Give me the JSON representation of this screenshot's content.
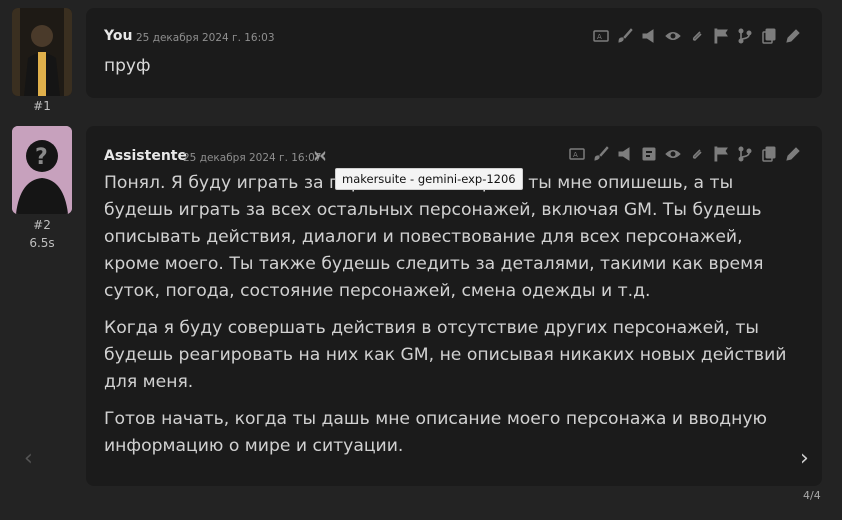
{
  "colors": {
    "background": "#232323",
    "bubble": "#1b1b1b",
    "text": "#d1d1d1",
    "muted": "#8f8f8f",
    "icon": "#7d7d7d",
    "avatar2_bg": "#c7a1bd"
  },
  "messages": [
    {
      "index_label": "#1",
      "author": "You",
      "timestamp": "25 декабря 2024 г. 16:03",
      "text": "пруф",
      "icons": [
        "translate-icon",
        "brush-icon",
        "megaphone-icon",
        "eye-icon",
        "paperclip-icon",
        "flag-icon",
        "branch-icon",
        "copy-icon",
        "pencil-icon"
      ]
    },
    {
      "index_label": "#2",
      "time_taken": "6.5s",
      "author": "Assistente",
      "timestamp": "25 декабря 2024 г. 16:07",
      "model_tooltip": "makersuite - gemini-exp-1206",
      "paragraphs": [
        "Понял. Я буду играть за персонажа, которого ты мне опишешь, а ты будешь играть за всех остальных персонажей, включая GM. Ты будешь описывать действия, диалоги и повествование для всех персонажей, кроме моего. Ты также будешь следить за деталями, такими как время суток, погода, состояние персонажей, смена одежды и т.д.",
        "Когда я буду совершать действия в отсутствие других персонажей, ты будешь реагировать на них как GM, не описывая никаких новых действий для меня.",
        "Готов начать, когда ты дашь мне описание моего персонажа и вводную информацию о мире и ситуации."
      ],
      "icons": [
        "translate-icon",
        "brush-icon",
        "megaphone-icon",
        "save-icon",
        "eye-icon",
        "paperclip-icon",
        "flag-icon",
        "branch-icon",
        "copy-icon",
        "pencil-icon"
      ]
    }
  ],
  "navigation": {
    "left_arrow": "‹",
    "right_arrow": "›",
    "swipe_counter": "4/4"
  }
}
